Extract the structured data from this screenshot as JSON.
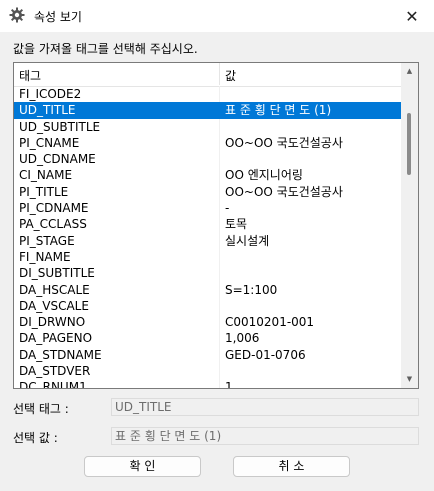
{
  "window": {
    "title": "속성 보기",
    "close_glyph": "✕"
  },
  "instruction": "값을 가져올 태그를 선택해 주십시오.",
  "table": {
    "headers": [
      "태그",
      "값"
    ],
    "rows": [
      {
        "tag": "FI_ICODE2",
        "value": ""
      },
      {
        "tag": "UD_TITLE",
        "value": "표 준 횡 단 면 도 (1)",
        "selected": true
      },
      {
        "tag": "UD_SUBTITLE",
        "value": ""
      },
      {
        "tag": "PI_CNAME",
        "value": "OO~OO 국도건설공사"
      },
      {
        "tag": "UD_CDNAME",
        "value": ""
      },
      {
        "tag": "CI_NAME",
        "value": "OO 엔지니어링"
      },
      {
        "tag": "PI_TITLE",
        "value": "OO~OO 국도건설공사"
      },
      {
        "tag": "PI_CDNAME",
        "value": "-"
      },
      {
        "tag": "PA_CCLASS",
        "value": "토목"
      },
      {
        "tag": "PI_STAGE",
        "value": "실시설계"
      },
      {
        "tag": "FI_NAME",
        "value": ""
      },
      {
        "tag": "DI_SUBTITLE",
        "value": ""
      },
      {
        "tag": "DA_HSCALE",
        "value": "S=1:100"
      },
      {
        "tag": "DA_VSCALE",
        "value": ""
      },
      {
        "tag": "DI_DRWNO",
        "value": "C0010201-001"
      },
      {
        "tag": "DA_PAGENO",
        "value": "1,006"
      },
      {
        "tag": "DA_STDNAME",
        "value": "GED-01-0706"
      },
      {
        "tag": "DA_STDVER",
        "value": ""
      },
      {
        "tag": "DC_RNUM1",
        "value": "1"
      }
    ]
  },
  "selected_tag": {
    "label": "선택 태그 :",
    "value": "UD_TITLE"
  },
  "selected_value": {
    "label": "선택 값 :",
    "value": "표 준 횡 단 면 도 (1)"
  },
  "buttons": {
    "ok": "확 인",
    "cancel": "취 소"
  }
}
